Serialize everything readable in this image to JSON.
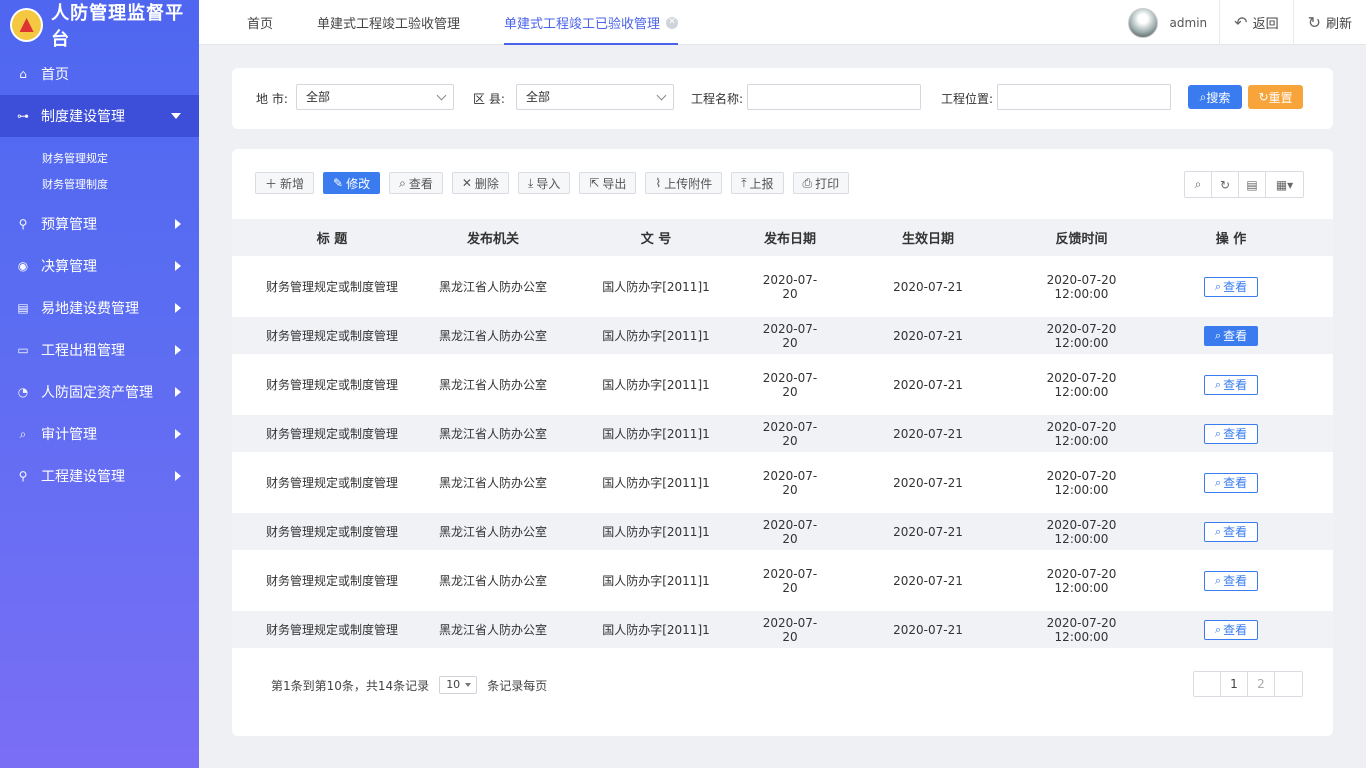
{
  "app": {
    "title": "人防管理监督平台"
  },
  "sidebar": {
    "items": [
      {
        "label": "首页",
        "icon": "home-icon",
        "glyph": "⌂"
      },
      {
        "label": "制度建设管理",
        "icon": "hierarchy-icon",
        "glyph": "⊶",
        "active": true,
        "children": [
          {
            "label": "财务管理规定"
          },
          {
            "label": "财务管理制度"
          }
        ]
      },
      {
        "label": "预算管理",
        "icon": "user-icon",
        "glyph": "⚲"
      },
      {
        "label": "决算管理",
        "icon": "target-icon",
        "glyph": "◉"
      },
      {
        "label": "易地建设费管理",
        "icon": "clipboard-icon",
        "glyph": "▤"
      },
      {
        "label": "工程出租管理",
        "icon": "monitor-icon",
        "glyph": "▭"
      },
      {
        "label": "人防固定资产管理",
        "icon": "pie-icon",
        "glyph": "◔"
      },
      {
        "label": "审计管理",
        "icon": "search-icon",
        "glyph": "⌕"
      },
      {
        "label": "工程建设管理",
        "icon": "user-icon",
        "glyph": "⚲"
      }
    ]
  },
  "topbar": {
    "tabs": [
      {
        "label": "首页"
      },
      {
        "label": "单建式工程竣工验收管理"
      },
      {
        "label": "单建式工程竣工已验收管理",
        "active": true,
        "closable": true
      }
    ],
    "user": "admin",
    "back_label": "返回",
    "refresh_label": "刷新"
  },
  "search": {
    "city_label": "地  市:",
    "city_value": "全部",
    "district_label": "区  县:",
    "district_value": "全部",
    "name_label": "工程名称:",
    "location_label": "工程位置:",
    "search_btn": "搜索",
    "reset_btn": "重置"
  },
  "toolbar": {
    "add": "新增",
    "edit": "修改",
    "view": "查看",
    "delete": "删除",
    "import": "导入",
    "export": "导出",
    "upload": "上传附件",
    "report": "上报",
    "print": "打印"
  },
  "table": {
    "headers": [
      "标  题",
      "发布机关",
      "文  号",
      "发布日期",
      "生效日期",
      "反馈时间",
      "操  作"
    ],
    "action_label": "查看",
    "rows": [
      [
        "财务管理规定或制度管理",
        "黑龙江省人防办公室",
        "国人防办字[2011]1",
        "2020-07-20",
        "2020-07-21",
        "2020-07-20 12:00:00"
      ],
      [
        "财务管理规定或制度管理",
        "黑龙江省人防办公室",
        "国人防办字[2011]1",
        "2020-07-20",
        "2020-07-21",
        "2020-07-20 12:00:00"
      ],
      [
        "财务管理规定或制度管理",
        "黑龙江省人防办公室",
        "国人防办字[2011]1",
        "2020-07-20",
        "2020-07-21",
        "2020-07-20 12:00:00"
      ],
      [
        "财务管理规定或制度管理",
        "黑龙江省人防办公室",
        "国人防办字[2011]1",
        "2020-07-20",
        "2020-07-21",
        "2020-07-20 12:00:00"
      ],
      [
        "财务管理规定或制度管理",
        "黑龙江省人防办公室",
        "国人防办字[2011]1",
        "2020-07-20",
        "2020-07-21",
        "2020-07-20 12:00:00"
      ],
      [
        "财务管理规定或制度管理",
        "黑龙江省人防办公室",
        "国人防办字[2011]1",
        "2020-07-20",
        "2020-07-21",
        "2020-07-20 12:00:00"
      ],
      [
        "财务管理规定或制度管理",
        "黑龙江省人防办公室",
        "国人防办字[2011]1",
        "2020-07-20",
        "2020-07-21",
        "2020-07-20 12:00:00"
      ],
      [
        "财务管理规定或制度管理",
        "黑龙江省人防办公室",
        "国人防办字[2011]1",
        "2020-07-20",
        "2020-07-21",
        "2020-07-20 12:00:00"
      ]
    ]
  },
  "pagination": {
    "summary": "第1条到第10条，共14条记录",
    "page_size": "10",
    "suffix": "条记录每页",
    "pages": [
      "1",
      "2"
    ]
  }
}
